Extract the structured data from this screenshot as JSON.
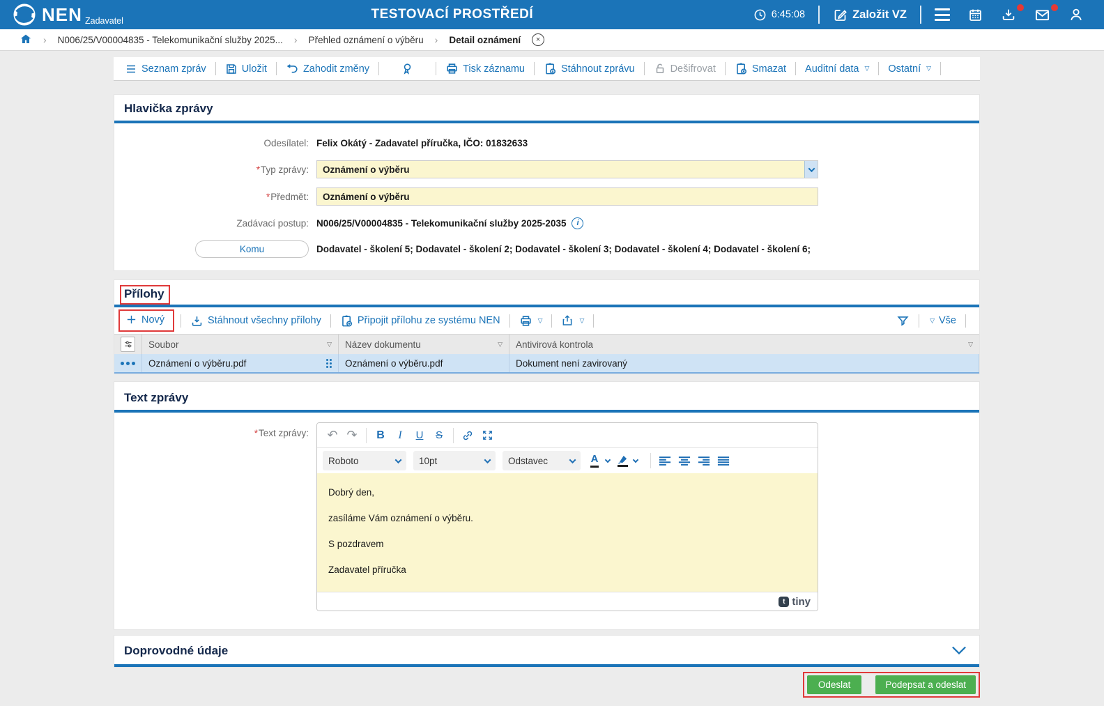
{
  "header": {
    "logo_text": "NEN",
    "logo_subtitle": "Zadavatel",
    "title": "TESTOVACÍ PROSTŘEDÍ",
    "time": "6:45:08",
    "create_vz_label": "Založit VZ"
  },
  "breadcrumb": {
    "items": [
      {
        "label": "N006/25/V00004835 - Telekomunikační služby 2025..."
      },
      {
        "label": "Přehled oznámení o výběru"
      },
      {
        "label": "Detail oznámení"
      }
    ]
  },
  "toolbar": {
    "seznam_zprav": "Seznam zpráv",
    "ulozit": "Uložit",
    "zahodit_zmeny": "Zahodit změny",
    "tisk_zaznamu": "Tisk záznamu",
    "stahnout_zpravu": "Stáhnout zprávu",
    "desifrovat": "Dešifrovat",
    "smazat": "Smazat",
    "auditni_data": "Auditní data",
    "ostatni": "Ostatní"
  },
  "message_header": {
    "section_title": "Hlavička zprávy",
    "required_mark": "*",
    "odesilatel_label": "Odesílatel:",
    "odesilatel_value": "Felix Okátý - Zadavatel příručka, IČO: 01832633",
    "typ_zpravy_label": "Typ zprávy:",
    "typ_zpravy_value": "Oznámení o výběru",
    "predmet_label": "Předmět:",
    "predmet_value": "Oznámení o výběru",
    "zadavaci_postup_label": "Zadávací postup:",
    "zadavaci_postup_value": "N006/25/V00004835 - Telekomunikační služby 2025-2035",
    "komu_button_label": "Komu",
    "komu_value": "Dodavatel - školení 5; Dodavatel - školení 2; Dodavatel - školení 3; Dodavatel - školení 4; Dodavatel - školení 6;"
  },
  "attachments": {
    "section_title": "Přílohy",
    "new_label": "Nový",
    "download_all_label": "Stáhnout všechny přílohy",
    "attach_from_nen_label": "Připojit přílohu ze systému NEN",
    "filter_all_label": "Vše",
    "columns": [
      "Soubor",
      "Název dokumentu",
      "Antivirová kontrola"
    ],
    "rows": [
      {
        "soubor": "Oznámení o výběru.pdf",
        "nazev_dokumentu": "Oznámení o výběru.pdf",
        "antivirova_kontrola": "Dokument není zavirovaný"
      }
    ]
  },
  "message_text": {
    "section_title": "Text zprávy",
    "required_mark": "*",
    "label": "Text zprávy:",
    "editor": {
      "font_name": "Roboto",
      "font_size": "10pt",
      "block_format": "Odstavec",
      "bold_glyph": "B",
      "italic_glyph": "I",
      "underline_glyph": "U",
      "strike_glyph": "S",
      "forecolor_glyph": "A",
      "paragraphs": [
        "Dobrý den,",
        "zasíláme Vám oznámení o výběru.",
        "S pozdravem",
        "Zadavatel příručka"
      ],
      "brand": "tiny"
    }
  },
  "accompanying_data": {
    "section_title": "Doprovodné údaje"
  },
  "footer": {
    "send_label": "Odeslat",
    "sign_and_send_label": "Podepsat a odeslat"
  },
  "colors": {
    "header_blue": "#1b74b8",
    "link_blue": "#1b74b8",
    "input_yellow": "#fbf6cf",
    "selected_row_blue": "#cfe3f5",
    "button_green": "#4caf50",
    "annotation_red": "#e03a3a"
  },
  "icons": {
    "nen-logo-icon": "circular swirl",
    "clock-icon": "clock face",
    "edit-icon": "pencil over square",
    "menu-icon": "hamburger bars",
    "calendar-icon": "calendar grid",
    "downloads-icon": "arrow into tray with red badge",
    "messages-icon": "envelope with red badge",
    "profile-icon": "person silhouette",
    "home-icon": "house",
    "close-icon": "circled x",
    "list-icon": "three lines",
    "save-icon": "floppy disk",
    "undo-icon": "curved arrow left",
    "award-icon": "rosette ribbon",
    "print-icon": "printer",
    "download-doc-icon": "document with download badge",
    "unlock-icon": "open padlock",
    "delete-doc-icon": "document with delete badge",
    "dropdown-triangle-icon": "small down triangle",
    "plus-icon": "plus sign",
    "download-icon": "arrow into tray",
    "attach-doc-icon": "document with plus badge",
    "share-icon": "box with up arrow",
    "filter-icon": "funnel",
    "column-settings-icon": "sliders",
    "row-menu-icon": "three dots",
    "drag-handle-icon": "six dots",
    "info-icon": "circled i",
    "undo-editor-icon": "curved arrow left",
    "redo-editor-icon": "curved arrow right",
    "link-icon": "chain link",
    "fullscreen-icon": "expand arrows",
    "forecolor-icon": "letter A with color bar",
    "highlight-icon": "highlighter pen with color bar",
    "align-left-icon": "left aligned lines",
    "align-center-icon": "centered lines",
    "align-right-icon": "right aligned lines",
    "justify-icon": "justified lines",
    "chevron-down-icon": "down chevron",
    "tiny-logo-icon": "tiny editor brand"
  }
}
